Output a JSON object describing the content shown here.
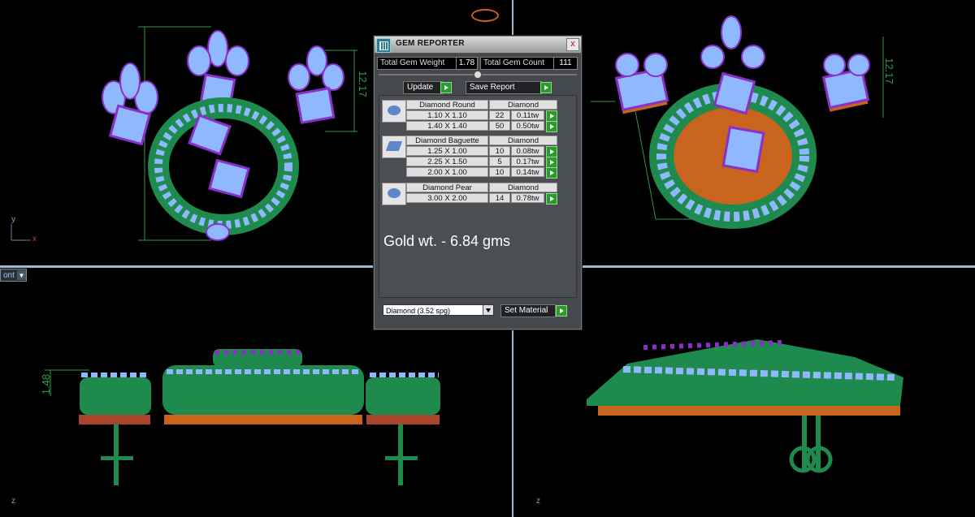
{
  "panel": {
    "title": "GEM REPORTER",
    "close_glyph": "x",
    "total_gem_weight_label": "Total Gem Weight",
    "total_gem_weight_value": "1.78",
    "total_gem_count_label": "Total Gem Count",
    "total_gem_count_value": "111",
    "update_label": "Update",
    "save_report_label": "Save Report",
    "groups": [
      {
        "name": "Diamond Round",
        "material": "Diamond",
        "icon": "round-gem-icon",
        "rows": [
          {
            "size": "1.10 X 1.10",
            "count": "22",
            "weight": "0.11tw"
          },
          {
            "size": "1.40 X 1.40",
            "count": "50",
            "weight": "0.50tw"
          }
        ]
      },
      {
        "name": "Diamond Baguette",
        "material": "Diamond",
        "icon": "baguette-gem-icon",
        "rows": [
          {
            "size": "1.25 X 1.00",
            "count": "10",
            "weight": "0.08tw"
          },
          {
            "size": "2.25 X 1.50",
            "count": "5",
            "weight": "0.17tw"
          },
          {
            "size": "2.00 X 1.00",
            "count": "10",
            "weight": "0.14tw"
          }
        ]
      },
      {
        "name": "Diamond Pear",
        "material": "Diamond",
        "icon": "pear-gem-icon",
        "rows": [
          {
            "size": "3.00 X 2.00",
            "count": "14",
            "weight": "0.78tw"
          }
        ]
      }
    ],
    "gold_weight_text": "Gold wt. - 6.84 gms",
    "material_select_value": "Diamond     (3.52 spg)",
    "set_material_label": "Set Material"
  },
  "viewports": {
    "view_menu_label": "ont",
    "dim_top_left": "12.17",
    "dim_top_right": "12.17",
    "dim_bottom_left": "1.48",
    "axis_y": "y",
    "axis_x": "x",
    "axis_z": "z"
  },
  "colors": {
    "metal_green": "#1e8a4e",
    "gem_blue": "#8fb8ff",
    "prong_purple": "#8a2fc9",
    "base_orange": "#c8641e",
    "dimension_green": "#2f9a4a"
  }
}
